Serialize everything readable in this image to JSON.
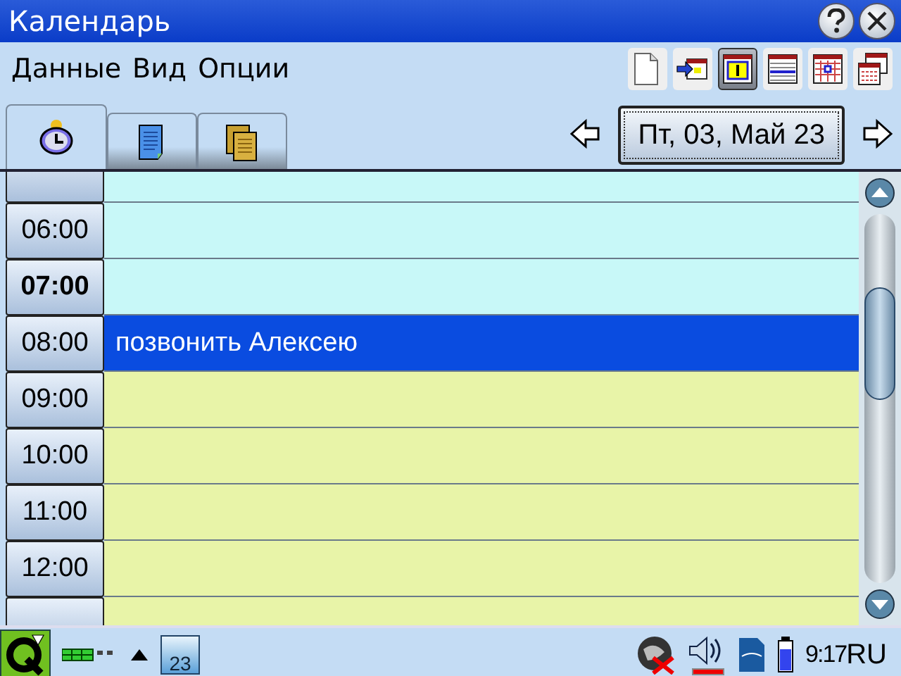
{
  "window": {
    "title": "Календарь"
  },
  "menu": [
    "Данные",
    "Вид",
    "Опции"
  ],
  "toolbar": [
    {
      "kind": "new"
    },
    {
      "kind": "import"
    },
    {
      "kind": "day",
      "selected": true
    },
    {
      "kind": "week",
      "selected": false
    },
    {
      "kind": "month",
      "selected": false
    },
    {
      "kind": "year",
      "selected": false
    }
  ],
  "tabs": [
    {
      "kind": "alarm",
      "selected": true
    },
    {
      "kind": "note",
      "selected": false
    },
    {
      "kind": "pages",
      "selected": false
    }
  ],
  "date": "Пт, 03, Май 23",
  "rows": [
    {
      "time": "06:00",
      "kind": "off",
      "current": false
    },
    {
      "time": "07:00",
      "kind": "off",
      "current": true
    },
    {
      "time": "08:00",
      "kind": "work",
      "current": false,
      "event": {
        "text": "позвонить Алексею",
        "selected": true
      }
    },
    {
      "time": "09:00",
      "kind": "work",
      "current": false
    },
    {
      "time": "10:00",
      "kind": "work",
      "current": false
    },
    {
      "time": "11:00",
      "kind": "work",
      "current": false
    },
    {
      "time": "12:00",
      "kind": "work",
      "current": false
    }
  ],
  "taskbar": {
    "calendar_day": "23",
    "time": "9:17",
    "lang": "RU"
  }
}
